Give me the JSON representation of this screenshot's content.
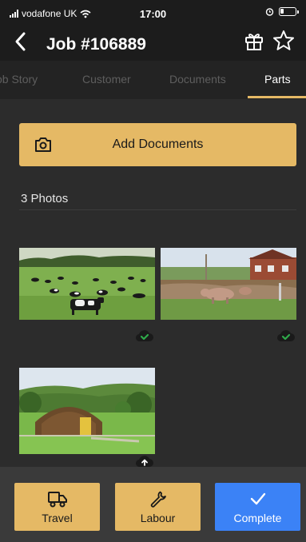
{
  "status_bar": {
    "carrier": "vodafone UK",
    "time": "17:00"
  },
  "header": {
    "title": "Job #106889",
    "icons": [
      "back-chevron-icon",
      "gift-icon",
      "star-icon"
    ]
  },
  "tabs": {
    "items": [
      {
        "label": "Job Story",
        "active": false
      },
      {
        "label": "Customer",
        "active": false
      },
      {
        "label": "Documents",
        "active": false
      },
      {
        "label": "Parts",
        "active": true
      }
    ]
  },
  "main": {
    "add_documents_label": "Add Documents",
    "photos_count_label": "3 Photos",
    "photos": [
      {
        "subject": "cows grazing in a field",
        "upload_status": "uploaded",
        "status_icon": "cloud-check-icon"
      },
      {
        "subject": "pigs by a farmhouse",
        "upload_status": "uploaded",
        "status_icon": "cloud-check-icon"
      },
      {
        "subject": "wooden camping pod on a hillside",
        "upload_status": "pending",
        "status_icon": "cloud-upload-icon"
      }
    ]
  },
  "bottom_actions": {
    "travel_label": "Travel",
    "labour_label": "Labour",
    "complete_label": "Complete"
  },
  "colors": {
    "accent": "#e5b965",
    "complete": "#3b82f6",
    "upload_ok": "#2faa4a",
    "background": "#2c2c2c"
  }
}
